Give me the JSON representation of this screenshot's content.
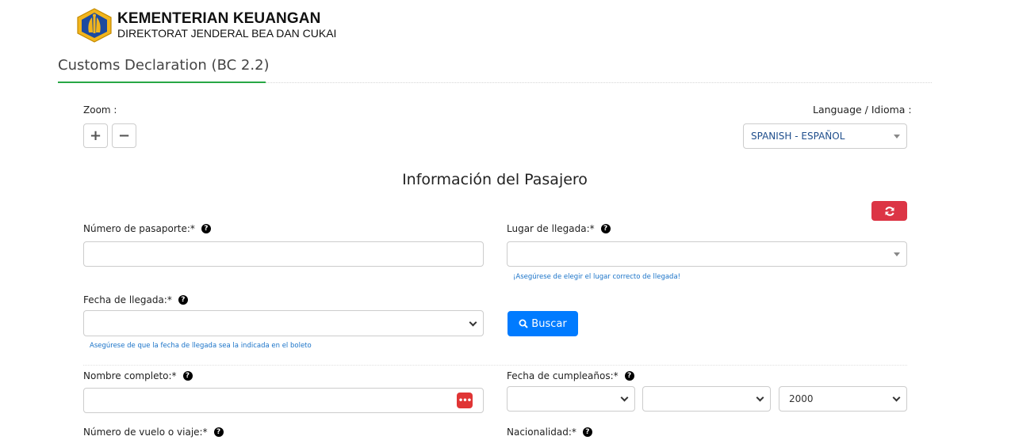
{
  "header": {
    "org_name": "KEMENTERIAN KEUANGAN",
    "org_sub": "DIREKTORAT JENDERAL BEA DAN CUKAI",
    "page_title": "Customs Declaration (BC 2.2)"
  },
  "controls": {
    "zoom_label": "Zoom :",
    "zoom_in": "+",
    "zoom_out": "−",
    "language_label": "Language / Idioma :",
    "language_value": "SPANISH - ESPAÑOL"
  },
  "section": {
    "title": "Información del Pasajero"
  },
  "form": {
    "passport_label": "Número de pasaporte:*",
    "arrival_place_label": "Lugar de llegada:*",
    "arrival_place_hint": "¡Asegúrese de elegir el lugar correcto de llegada!",
    "arrival_date_label": "Fecha de llegada:*",
    "arrival_date_hint": "Asegúrese de que la fecha de llegada sea la indicada en el boleto",
    "search_label": "Buscar",
    "full_name_label": "Nombre completo:*",
    "birthday_label": "Fecha de cumpleaños:*",
    "birthday_year": "2000",
    "flight_label": "Número de vuelo o viaje:*",
    "nationality_label": "Nacionalidad:*",
    "dots": "•••"
  },
  "colors": {
    "accent_green": "#28a745",
    "primary_blue": "#007bff",
    "danger_red": "#dc3545"
  }
}
